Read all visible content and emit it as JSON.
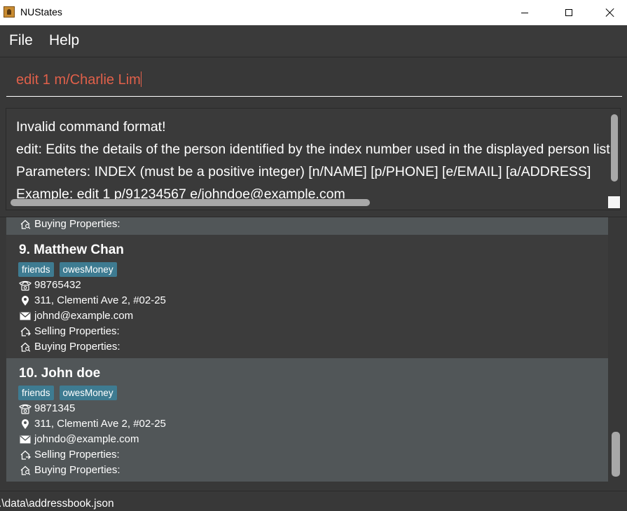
{
  "window": {
    "title": "NUStates"
  },
  "menu": {
    "file": "File",
    "help": "Help"
  },
  "command": {
    "value": "edit 1 m/Charlie Lim"
  },
  "result": {
    "lines": [
      "Invalid command format!",
      "edit: Edits the details of the person identified by the index number used in the displayed person list.",
      "Parameters: INDEX (must be a positive integer) [n/NAME] [p/PHONE] [e/EMAIL] [a/ADDRESS]",
      "Example: edit 1 p/91234567 e/johndoe@example.com"
    ]
  },
  "persons": {
    "partial": {
      "buying_label": "Buying Properties:"
    },
    "cards": [
      {
        "name": "9. Matthew Chan",
        "tags": [
          "friends",
          "owesMoney"
        ],
        "phone": "98765432",
        "address": "311, Clementi Ave 2, #02-25",
        "email": "johnd@example.com",
        "selling_label": "Selling Properties:",
        "buying_label": "Buying Properties:"
      },
      {
        "name": "10. John doe",
        "tags": [
          "friends",
          "owesMoney"
        ],
        "phone": "9871345",
        "address": "311, Clementi Ave 2, #02-25",
        "email": "johndo@example.com",
        "selling_label": "Selling Properties:",
        "buying_label": "Buying Properties:"
      }
    ]
  },
  "status": {
    "path": ".\\data\\addressbook.json"
  },
  "colors": {
    "background": "#383838",
    "card_odd": "#3c3c3c",
    "card_even": "#515658",
    "tag": "#3e7b91",
    "command_text": "#e0604a"
  },
  "icons": {
    "phone": "phone-icon",
    "address": "location-pin-icon",
    "email": "envelope-icon",
    "selling": "house-arrow-icon",
    "buying": "house-search-icon"
  }
}
